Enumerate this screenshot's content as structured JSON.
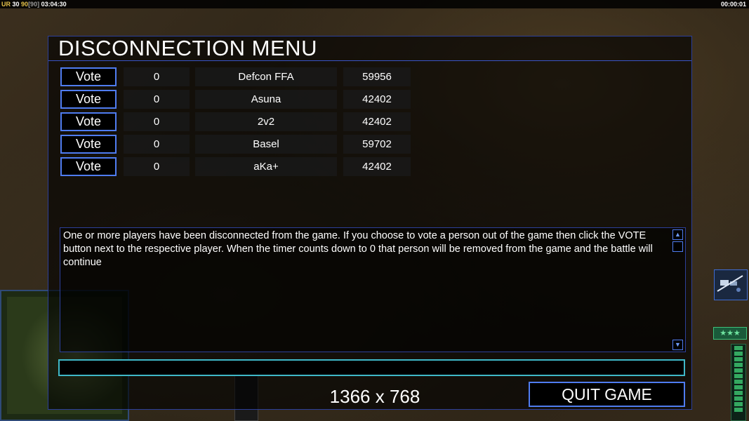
{
  "hud": {
    "left_prefix": "UR",
    "val1": "30",
    "val2": "90",
    "val3": "[90]",
    "clock": "03:04:30",
    "right_timer": "00:00:01",
    "rank_stars": "★★★"
  },
  "dialog": {
    "title": "DISCONNECTION MENU",
    "players": [
      {
        "vote_label": "Vote",
        "timer": "0",
        "name": "Defcon FFA",
        "ping": "59956"
      },
      {
        "vote_label": "Vote",
        "timer": "0",
        "name": "Asuna",
        "ping": "42402"
      },
      {
        "vote_label": "Vote",
        "timer": "0",
        "name": "2v2",
        "ping": "42402"
      },
      {
        "vote_label": "Vote",
        "timer": "0",
        "name": "Basel",
        "ping": "59702"
      },
      {
        "vote_label": "Vote",
        "timer": "0",
        "name": "aKa+",
        "ping": "42402"
      }
    ],
    "message": "One or more players have been disconnected from the game. If you choose to vote a person out of the game then click the VOTE button next to the respective player. When the timer counts down to 0 that person will be removed from the game and the battle will continue",
    "chat_value": "",
    "resolution": "1366 x 768",
    "quit_label": "QUIT GAME"
  },
  "colors": {
    "frame_blue": "#2c3f9a",
    "button_border": "#4f7cf0",
    "input_border": "#3fb8c8",
    "hud_yellow": "#e6c34a"
  },
  "icons": {
    "scroll_up": "triangle-up-icon",
    "scroll_down": "triangle-down-icon"
  }
}
